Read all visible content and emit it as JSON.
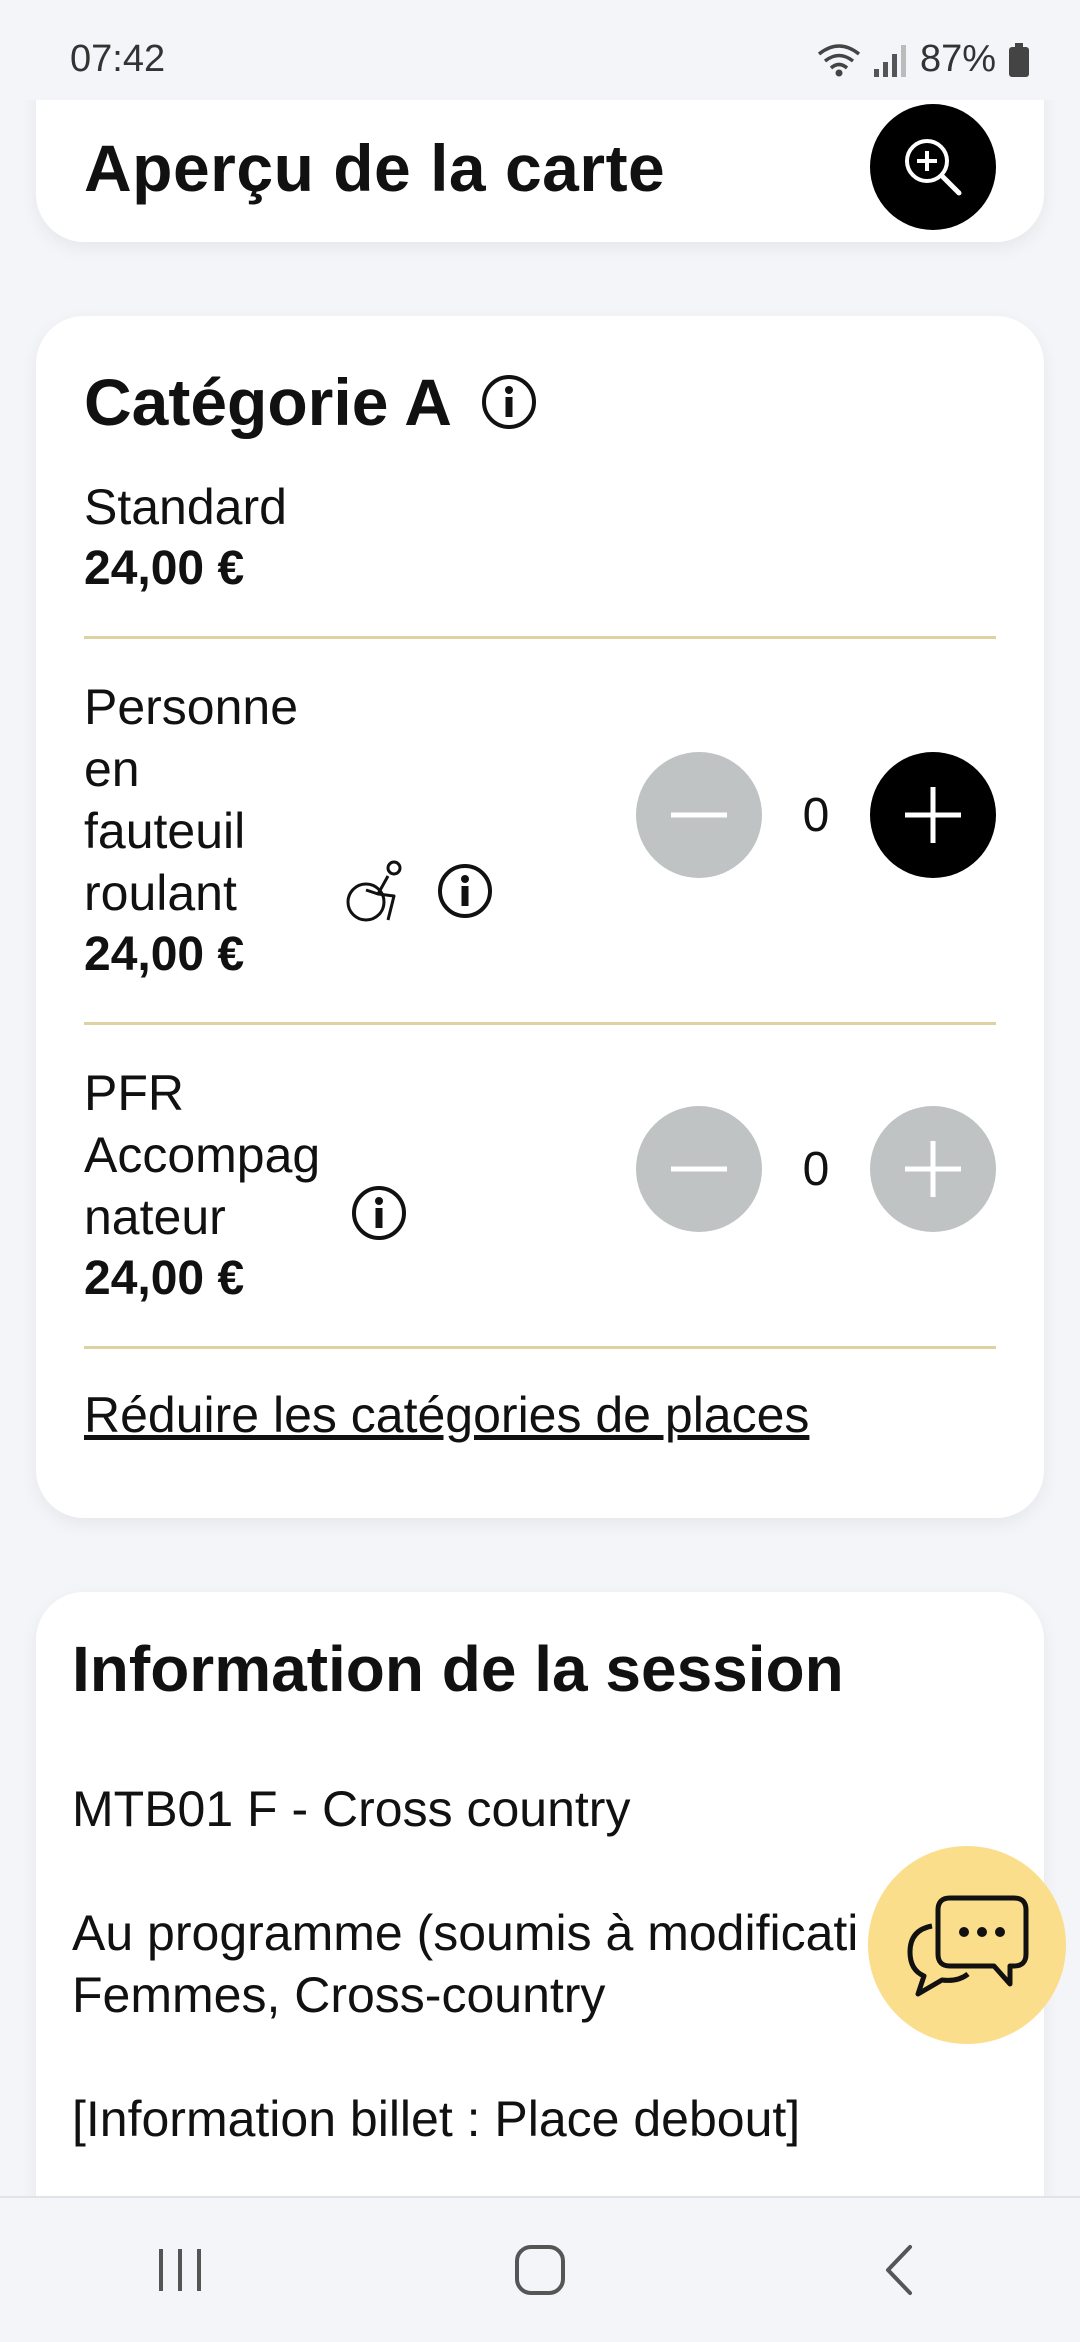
{
  "status_bar": {
    "time": "07:42",
    "battery": "87%"
  },
  "map_card": {
    "title": "Aperçu de la carte"
  },
  "category_card": {
    "title": "Catégorie A",
    "rows": [
      {
        "label_lines": [
          "Standard"
        ],
        "price": "24,00 €"
      },
      {
        "label_lines": [
          "Personne",
          "en",
          "fauteuil",
          "roulant"
        ],
        "price": "24,00 €",
        "quantity": "0"
      },
      {
        "label_lines": [
          "PFR",
          "Accompag",
          "nateur"
        ],
        "price": "24,00 €",
        "quantity": "0"
      }
    ],
    "reduce_link": "Réduire les catégories de places"
  },
  "session_card": {
    "title": "Information de la session",
    "line1": "MTB01 F - Cross country",
    "line2": "Au programme (soumis à modificati",
    "line3": "Femmes, Cross-country",
    "line4": "[Information billet : Place debout]"
  },
  "colors": {
    "accent_yellow": "#fbde8c",
    "divider": "#ddd2a0",
    "disabled_button": "#bfc3c4",
    "active_button": "#000000"
  }
}
